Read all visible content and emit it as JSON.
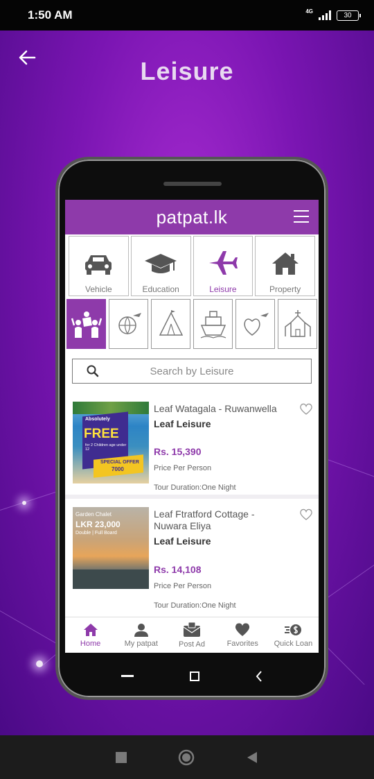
{
  "status": {
    "time": "1:50 AM",
    "network": "4G",
    "battery": "30"
  },
  "header": {
    "title": "Leisure"
  },
  "app": {
    "brand": "patpat.lk",
    "categories": [
      {
        "label": "Vehicle",
        "icon": "car-icon"
      },
      {
        "label": "Education",
        "icon": "graduation-cap-icon"
      },
      {
        "label": "Leisure",
        "icon": "airplane-icon"
      },
      {
        "label": "Property",
        "icon": "house-icon"
      }
    ],
    "subcategories": [
      {
        "icon": "people-activity-icon"
      },
      {
        "icon": "world-travel-icon"
      },
      {
        "icon": "tent-icon"
      },
      {
        "icon": "ship-icon"
      },
      {
        "icon": "honeymoon-icon"
      },
      {
        "icon": "church-icon"
      }
    ],
    "search": {
      "placeholder": "Search by Leisure"
    },
    "listings": [
      {
        "title": "Leaf Watagala - Ruwanwella",
        "provider": "Leaf Leisure",
        "price": "Rs. 15,390",
        "price_note": "Price Per Person",
        "duration": "Tour Duration:One Night",
        "thumb_text": {
          "small": "Absolutely",
          "big": "FREE",
          "sub": "for 2 Children age under 12",
          "offer": "SPECIAL OFFER",
          "offer_value": "7000"
        }
      },
      {
        "title": "Leaf Ftratford Cottage - Nuwara Eliya",
        "provider": "Leaf Leisure",
        "price": "Rs. 14,108",
        "price_note": "Price Per Person",
        "duration": "Tour Duration:One Night",
        "thumb_text": {
          "small": "Garden Chalet",
          "big": "LKR 23,000",
          "sub": "Double | Full Board"
        }
      }
    ],
    "nav": [
      {
        "label": "Home",
        "icon": "home-icon"
      },
      {
        "label": "My patpat",
        "icon": "person-icon"
      },
      {
        "label": "Post Ad",
        "icon": "post-ad-icon"
      },
      {
        "label": "Favorites",
        "icon": "heart-icon"
      },
      {
        "label": "Quick Loan",
        "icon": "loan-icon"
      }
    ]
  },
  "colors": {
    "accent": "#8e3aaa",
    "background": "#7a15b2"
  }
}
